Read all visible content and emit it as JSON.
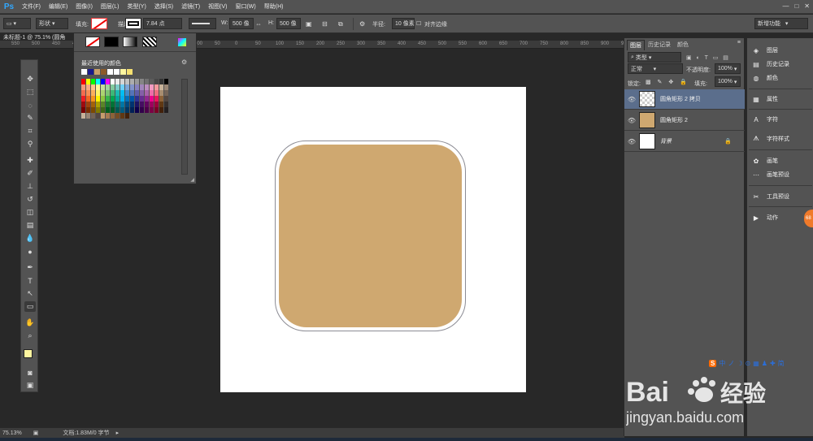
{
  "app": {
    "logo": "Ps"
  },
  "menu": [
    "文件(F)",
    "编辑(E)",
    "图像(I)",
    "图层(L)",
    "类型(Y)",
    "选择(S)",
    "滤镜(T)",
    "视图(V)",
    "窗口(W)",
    "帮助(H)"
  ],
  "window_controls": [
    "—",
    "□",
    "✕"
  ],
  "options": {
    "mode": "形状",
    "fill_label": "填充:",
    "stroke_label": "描边:",
    "stroke_width": "7.84 点",
    "w_label": "W:",
    "w_value": "500 像",
    "h_label": "H:",
    "h_value": "500 像",
    "radius_label": "半径:",
    "radius_value": "10 像素",
    "align_edges": "对齐边缘",
    "workspace": "新增功能"
  },
  "document": {
    "tab": "未标题-1 @ 75.1% (圆角"
  },
  "ruler_ticks": [
    "550",
    "500",
    "450",
    "400",
    "350",
    "300",
    "250",
    "200",
    "150",
    "100",
    "50",
    "0",
    "50",
    "100",
    "150",
    "200",
    "250",
    "300",
    "350",
    "400",
    "450",
    "500",
    "550",
    "600",
    "650",
    "700",
    "750",
    "800",
    "850",
    "900",
    "950",
    "1000"
  ],
  "fill_popup": {
    "recent_label": "最近使用的颜色",
    "recent_colors": [
      "#ffffff",
      "#1a1a8c",
      "#c8a06a",
      "#8c5a2a",
      "#ffffff",
      "#ffffff",
      "#fff6a0",
      "#f6e070"
    ],
    "palette": [
      [
        "#ff0000",
        "#ffff00",
        "#00ff00",
        "#00ffff",
        "#0000ff",
        "#ff00ff",
        "#ffffff",
        "#ebebeb",
        "#d6d6d6",
        "#c2c2c2",
        "#adadad",
        "#999999",
        "#858585",
        "#707070",
        "#5c5c5c",
        "#474747",
        "#333333",
        "#000000"
      ],
      [
        "#f7977a",
        "#fbad82",
        "#fdc68c",
        "#fff799",
        "#c6df9c",
        "#a4d49d",
        "#81ca9d",
        "#7bcdc8",
        "#6ccff7",
        "#7ca6d8",
        "#8293ca",
        "#8881be",
        "#a286bd",
        "#bc8cbf",
        "#f49bc1",
        "#f5999d",
        "#c7b299",
        "#998675"
      ],
      [
        "#f26c4f",
        "#f68e56",
        "#fbaf5c",
        "#fff467",
        "#acd372",
        "#7dc473",
        "#3cb878",
        "#1cbbb4",
        "#00bff3",
        "#438cca",
        "#5574b9",
        "#605ca8",
        "#855fa8",
        "#a763a9",
        "#ef6ea8",
        "#f16d7e",
        "#a88d70",
        "#736357"
      ],
      [
        "#ed1c24",
        "#f26522",
        "#f7941d",
        "#fff200",
        "#8dc63f",
        "#39b54a",
        "#00a651",
        "#00a99d",
        "#00aeef",
        "#0072bc",
        "#0054a5",
        "#2e3192",
        "#662d91",
        "#92278f",
        "#ec008c",
        "#ed145b",
        "#8c6239",
        "#534741"
      ],
      [
        "#9e0b0f",
        "#a0410d",
        "#a36209",
        "#aba000",
        "#598527",
        "#1a7b30",
        "#007236",
        "#00746b",
        "#0076a4",
        "#004a80",
        "#003370",
        "#1d1363",
        "#450e61",
        "#62055f",
        "#9e005d",
        "#9d0039",
        "#603813",
        "#362f2d"
      ],
      [
        "#790000",
        "#7b2e00",
        "#7d4900",
        "#827b00",
        "#406618",
        "#005e20",
        "#005826",
        "#005952",
        "#005b7f",
        "#003663",
        "#002157",
        "#0d004c",
        "#32004b",
        "#4b0049",
        "#7b0046",
        "#7a0026",
        "#42210b",
        "#231f20"
      ],
      [
        "#c7b299",
        "#998675",
        "#736357",
        "#534741",
        "#c69c6d",
        "#a67c52",
        "#8c6239",
        "#754c24",
        "#603813",
        "#42210b"
      ]
    ]
  },
  "layers_panel": {
    "tabs": [
      "图层",
      "历史记录",
      "颜色"
    ],
    "kind": "类型",
    "blend_mode": "正常",
    "opacity_label": "不透明度:",
    "opacity_value": "100%",
    "lock_label": "锁定:",
    "fill_label": "填充:",
    "fill_value": "100%",
    "layers": [
      {
        "name": "圆角矩形 2 拷贝",
        "selected": true
      },
      {
        "name": "圆角矩形 2",
        "selected": false
      },
      {
        "name": "背景",
        "selected": false
      }
    ]
  },
  "right_dock": [
    "图层",
    "历史记录",
    "颜色",
    "属性",
    "字符",
    "字符样式",
    "画笔",
    "画笔预设",
    "工具预设",
    "动作"
  ],
  "status": {
    "zoom": "75.13%",
    "doc": "文档:1.83M/0 字节"
  },
  "shape": {
    "fill_color": "#cfa870",
    "stroke_color": "#8c8c94"
  },
  "ime": {
    "items": [
      "S",
      "中",
      "ノ",
      "☽",
      "⊙",
      "▦",
      "♟",
      "✚",
      "简"
    ]
  },
  "watermark": {
    "brand": "Bai",
    "brand2": "经验",
    "url": "jingyan.baidu.com"
  },
  "badge": "68"
}
